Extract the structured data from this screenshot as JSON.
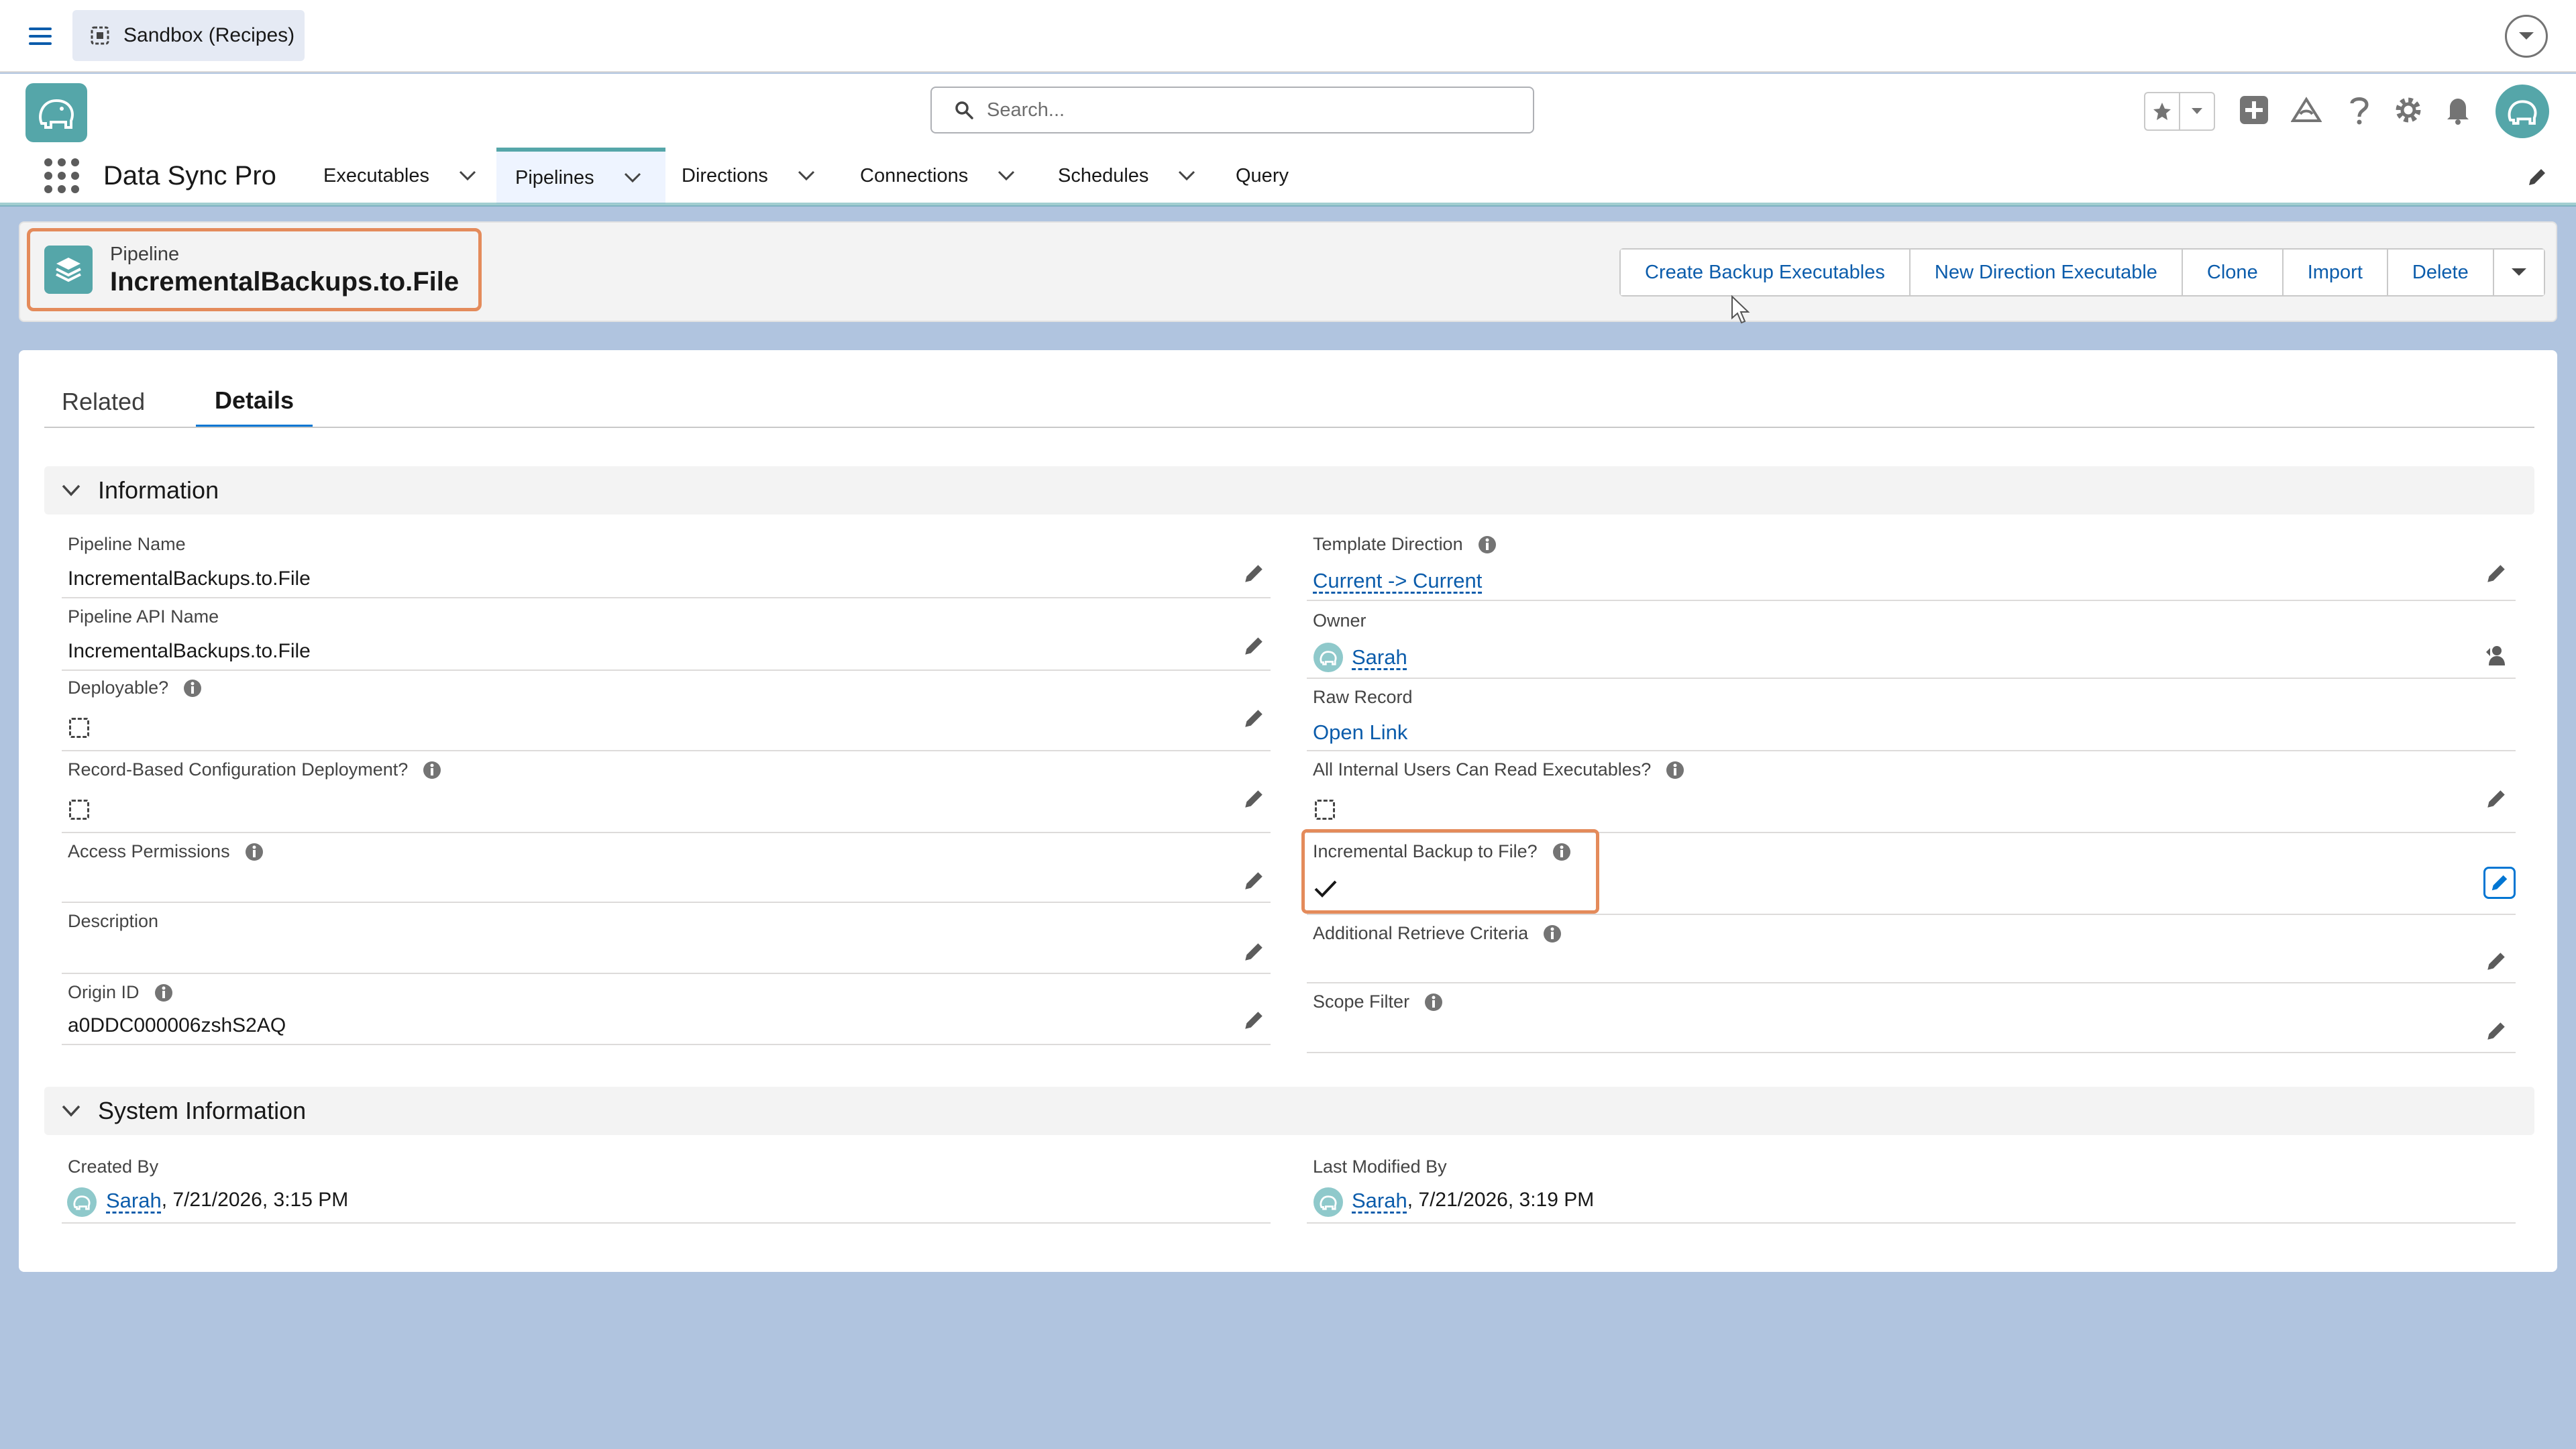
{
  "topbar": {
    "org_label": "Sandbox (Recipes)"
  },
  "header": {
    "search_placeholder": "Search..."
  },
  "nav": {
    "app_name": "Data Sync Pro",
    "items": [
      "Executables",
      "Pipelines",
      "Directions",
      "Connections",
      "Schedules",
      "Query"
    ]
  },
  "record": {
    "type_label": "Pipeline",
    "title": "IncrementalBackups.to.File",
    "actions": [
      "Create Backup Executables",
      "New Direction Executable",
      "Clone",
      "Import",
      "Delete"
    ]
  },
  "tabs": {
    "related": "Related",
    "details": "Details"
  },
  "info_section": {
    "title": "Information",
    "pipeline_name_label": "Pipeline Name",
    "pipeline_name_value": "IncrementalBackups.to.File",
    "pipeline_api_label": "Pipeline API Name",
    "pipeline_api_value": "IncrementalBackups.to.File",
    "deployable_label": "Deployable?",
    "deployable_value": false,
    "record_based_label": "Record-Based Configuration Deployment?",
    "record_based_value": false,
    "access_permissions_label": "Access Permissions",
    "description_label": "Description",
    "origin_id_label": "Origin ID",
    "origin_id_value": "a0DDC000006zshS2AQ",
    "template_direction_label": "Template Direction",
    "template_direction_value": "Current -> Current",
    "owner_label": "Owner",
    "owner_value": "Sarah",
    "raw_record_label": "Raw Record",
    "raw_record_value": "Open Link",
    "all_internal_label": "All Internal Users Can Read Executables?",
    "all_internal_value": false,
    "incremental_label": "Incremental Backup to File?",
    "incremental_value": true,
    "additional_retrieve_label": "Additional Retrieve Criteria",
    "scope_filter_label": "Scope Filter"
  },
  "system_section": {
    "title": "System Information",
    "created_by_label": "Created By",
    "created_by_user": "Sarah",
    "created_by_date": ", 7/21/2026, 3:15 PM",
    "modified_by_label": "Last Modified By",
    "modified_by_user": "Sarah",
    "modified_by_date": ", 7/21/2026, 3:19 PM"
  },
  "colors": {
    "brand_teal": "#55a6a9",
    "link_blue": "#0b5cab",
    "highlight_orange": "#e48b5b",
    "page_background": "#b0c4df"
  }
}
